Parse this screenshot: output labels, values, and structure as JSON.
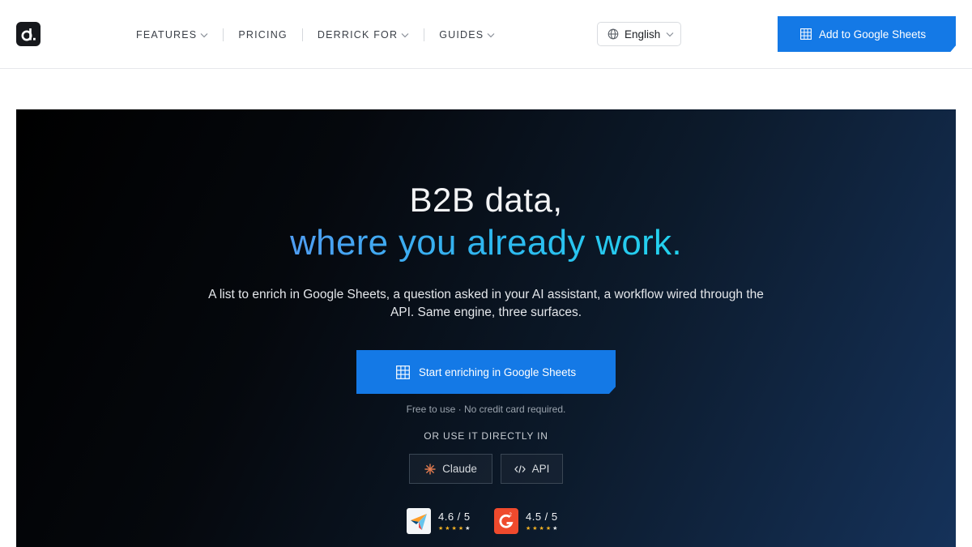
{
  "brand": {
    "logo_letter": "d."
  },
  "nav": {
    "items": [
      {
        "label": "FEATURES",
        "has_dropdown": true
      },
      {
        "label": "PRICING",
        "has_dropdown": false
      },
      {
        "label": "DERRICK FOR",
        "has_dropdown": true
      },
      {
        "label": "GUIDES",
        "has_dropdown": true
      }
    ]
  },
  "language": {
    "selected": "English",
    "icon": "globe-icon"
  },
  "header_cta": {
    "label": "Add to Google Sheets",
    "icon": "grid-icon"
  },
  "hero": {
    "title_line1": "B2B data,",
    "title_line2": "where you already work.",
    "subtitle": "A list to enrich in Google Sheets, a question asked in your AI assistant, a workflow wired through the API. Same engine, three surfaces.",
    "cta_label": "Start enriching in Google Sheets",
    "note": "Free to use · No credit card required.",
    "or_label": "OR USE IT DIRECTLY IN",
    "chips": [
      {
        "label": "Claude",
        "icon": "claude-sparkle-icon"
      },
      {
        "label": "API",
        "icon": "code-icon"
      }
    ],
    "ratings": [
      {
        "score": "4.6 / 5",
        "stars": 4.5,
        "source_icon": "capterra-logo-icon"
      },
      {
        "score": "4.5 / 5",
        "stars": 4.5,
        "source_icon": "g2-logo-icon"
      }
    ]
  },
  "colors": {
    "accent": "#1479e6",
    "gradient_start": "#4f9df2",
    "gradient_end": "#22d3ee",
    "star": "#f5b323"
  }
}
